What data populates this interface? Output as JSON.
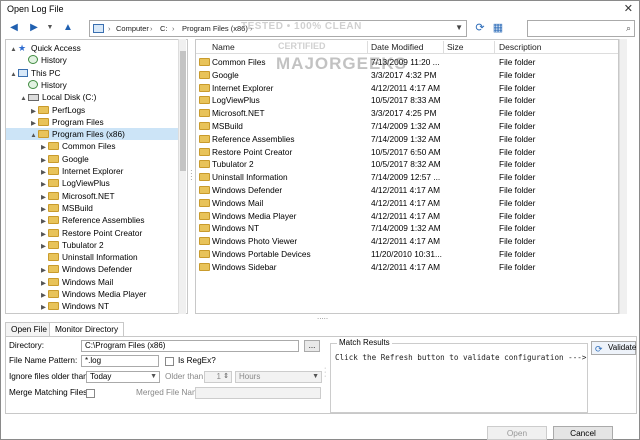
{
  "window": {
    "title": "Open Log File",
    "close_glyph": "✕"
  },
  "toolbar": {
    "address": {
      "parts": [
        "Computer",
        "C:",
        "Program Files (x86)"
      ],
      "separator": "›"
    },
    "back_icon": "back-arrow-icon",
    "forward_icon": "forward-arrow-icon",
    "up_icon": "up-arrow-icon",
    "refresh_icon": "refresh-icon",
    "view_icon": "view-icon",
    "search_placeholder": ""
  },
  "tree": {
    "items": [
      {
        "label": "Quick Access",
        "icon": "star",
        "expand": "▲",
        "indent": 0
      },
      {
        "label": "History",
        "icon": "history",
        "expand": "",
        "indent": 1
      },
      {
        "label": "This PC",
        "icon": "pc",
        "expand": "▲",
        "indent": 0
      },
      {
        "label": "History",
        "icon": "history",
        "expand": "",
        "indent": 1
      },
      {
        "label": "Local Disk (C:)",
        "icon": "drive",
        "expand": "▲",
        "indent": 1
      },
      {
        "label": "PerfLogs",
        "icon": "folder",
        "expand": "▶",
        "indent": 2
      },
      {
        "label": "Program Files",
        "icon": "folder",
        "expand": "▶",
        "indent": 2
      },
      {
        "label": "Program Files (x86)",
        "icon": "folder",
        "expand": "▲",
        "indent": 2,
        "selected": true
      },
      {
        "label": "Common Files",
        "icon": "folder",
        "expand": "▶",
        "indent": 3
      },
      {
        "label": "Google",
        "icon": "folder",
        "expand": "▶",
        "indent": 3
      },
      {
        "label": "Internet Explorer",
        "icon": "folder",
        "expand": "▶",
        "indent": 3
      },
      {
        "label": "LogViewPlus",
        "icon": "folder",
        "expand": "▶",
        "indent": 3
      },
      {
        "label": "Microsoft.NET",
        "icon": "folder",
        "expand": "▶",
        "indent": 3
      },
      {
        "label": "MSBuild",
        "icon": "folder",
        "expand": "▶",
        "indent": 3
      },
      {
        "label": "Reference Assemblies",
        "icon": "folder",
        "expand": "▶",
        "indent": 3
      },
      {
        "label": "Restore Point Creator",
        "icon": "folder",
        "expand": "▶",
        "indent": 3
      },
      {
        "label": "Tubulator 2",
        "icon": "folder",
        "expand": "▶",
        "indent": 3
      },
      {
        "label": "Uninstall Information",
        "icon": "folder",
        "expand": "",
        "indent": 3
      },
      {
        "label": "Windows Defender",
        "icon": "folder",
        "expand": "▶",
        "indent": 3
      },
      {
        "label": "Windows Mail",
        "icon": "folder",
        "expand": "▶",
        "indent": 3
      },
      {
        "label": "Windows Media Player",
        "icon": "folder",
        "expand": "▶",
        "indent": 3
      },
      {
        "label": "Windows NT",
        "icon": "folder",
        "expand": "▶",
        "indent": 3
      }
    ]
  },
  "list": {
    "columns": [
      "Name",
      "Date Modified",
      "Size",
      "Description"
    ],
    "rows": [
      [
        "Common Files",
        "7/13/2009 11:20 ...",
        "",
        "File folder"
      ],
      [
        "Google",
        "3/3/2017 4:32 PM",
        "",
        "File folder"
      ],
      [
        "Internet Explorer",
        "4/12/2011 4:17 AM",
        "",
        "File folder"
      ],
      [
        "LogViewPlus",
        "10/5/2017 8:33 AM",
        "",
        "File folder"
      ],
      [
        "Microsoft.NET",
        "3/3/2017 4:25 PM",
        "",
        "File folder"
      ],
      [
        "MSBuild",
        "7/14/2009 1:32 AM",
        "",
        "File folder"
      ],
      [
        "Reference Assemblies",
        "7/14/2009 1:32 AM",
        "",
        "File folder"
      ],
      [
        "Restore Point Creator",
        "10/5/2017 6:50 AM",
        "",
        "File folder"
      ],
      [
        "Tubulator 2",
        "10/5/2017 8:32 AM",
        "",
        "File folder"
      ],
      [
        "Uninstall Information",
        "7/14/2009 12:57 ...",
        "",
        "File folder"
      ],
      [
        "Windows Defender",
        "4/12/2011 4:17 AM",
        "",
        "File folder"
      ],
      [
        "Windows Mail",
        "4/12/2011 4:17 AM",
        "",
        "File folder"
      ],
      [
        "Windows Media Player",
        "4/12/2011 4:17 AM",
        "",
        "File folder"
      ],
      [
        "Windows NT",
        "7/14/2009 1:32 AM",
        "",
        "File folder"
      ],
      [
        "Windows Photo Viewer",
        "4/12/2011 4:17 AM",
        "",
        "File folder"
      ],
      [
        "Windows Portable Devices",
        "11/20/2010 10:31...",
        "",
        "File folder"
      ],
      [
        "Windows Sidebar",
        "4/12/2011 4:17 AM",
        "",
        "File folder"
      ]
    ]
  },
  "watermark": {
    "line1": "TESTED • 100% CLEAN",
    "line2": "CERTIFIED",
    "line3": "MAJORGEEKS"
  },
  "tabs": [
    "Open File",
    "Monitor Directory"
  ],
  "form": {
    "directory_label": "Directory:",
    "directory_value": "C:\\Program Files (x86)",
    "browse_label": "...",
    "pattern_label": "File Name Pattern:",
    "pattern_value": "*.log",
    "regex_label": "Is RegEx?",
    "ignore_label": "Ignore files older than:",
    "ignore_value": "Today",
    "older_label": "Older than:",
    "older_value": "1",
    "older_unit": "Hours",
    "merge_label": "Merge Matching Files:",
    "merged_name_label": "Merged File Name:",
    "merged_name_value": ""
  },
  "match": {
    "caption": "Match Results",
    "message": "Click the Refresh button to validate configuration --->",
    "validate_label": "Validate"
  },
  "footer": {
    "open_label": "Open",
    "cancel_label": "Cancel"
  }
}
